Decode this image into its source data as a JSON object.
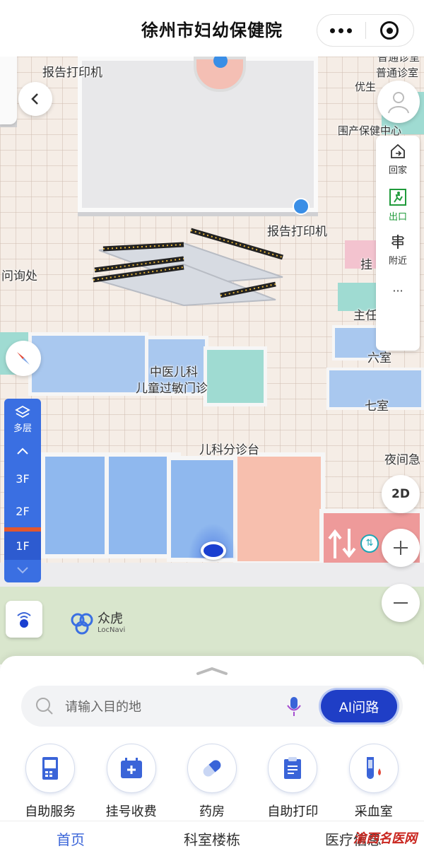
{
  "header": {
    "title": "徐州市妇幼保健院"
  },
  "map": {
    "labels": {
      "print_top_left": "报告打印机",
      "print_center": "报告打印机",
      "info_desk": "问询处",
      "tcm_peds": "中医儿科",
      "allergy": "儿童过敏门诊",
      "peds_triage": "儿科分诊台",
      "general_clinic": "普通诊室",
      "youshe": "优生",
      "perinatal": "围产保健中心",
      "registration": "挂",
      "zhuren": "主任",
      "room6": "六室",
      "room7": "七室",
      "night": "夜间急",
      "top_edge": "普通诊室"
    },
    "brand": {
      "name": "众虎",
      "sub": "LocNavi"
    }
  },
  "toolbar": {
    "home": "回家",
    "exit": "出口",
    "nearby": "附近",
    "more": "···"
  },
  "floors": {
    "multi": "多层",
    "items": [
      "3F",
      "2F",
      "1F"
    ],
    "active": "1F"
  },
  "view_toggle": "2D",
  "search": {
    "placeholder": "请输入目的地",
    "ai_label": "AI问路"
  },
  "quick": [
    {
      "label": "自助服务",
      "icon": "kiosk-icon"
    },
    {
      "label": "挂号收费",
      "icon": "registration-icon"
    },
    {
      "label": "药房",
      "icon": "pill-icon"
    },
    {
      "label": "自助打印",
      "icon": "report-icon"
    },
    {
      "label": "采血室",
      "icon": "blood-tube-icon"
    }
  ],
  "tabs": [
    "首页",
    "科室楼栋",
    "医疗信息"
  ],
  "watermark": "渝西名医网",
  "colors": {
    "accent": "#3a64d8",
    "floor_bar": "#3a6fe2",
    "exit_green": "#1f9a3a",
    "room_blue": "#8fb8ee"
  }
}
